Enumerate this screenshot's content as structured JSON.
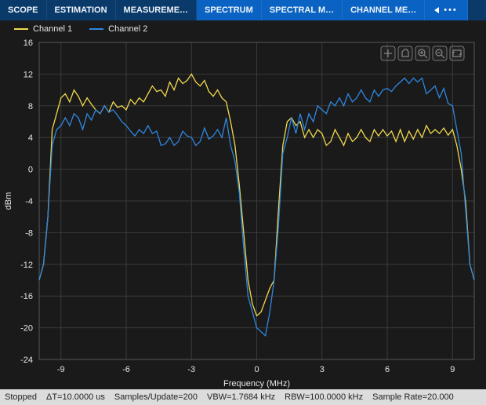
{
  "tabs": {
    "scope": "SCOPE",
    "estimation": "ESTIMATION",
    "measure": "MEASUREME…",
    "spectrum": "SPECTRUM",
    "spectral": "SPECTRAL M…",
    "channel": "CHANNEL ME…",
    "more": "•••"
  },
  "legend": {
    "ch1": {
      "label": "Channel 1",
      "color": "#f2d94e"
    },
    "ch2": {
      "label": "Channel 2",
      "color": "#2f87e0"
    }
  },
  "axes": {
    "xlabel": "Frequency (MHz)",
    "ylabel": "dBm"
  },
  "status": {
    "state": "Stopped",
    "dt": "ΔT=10.0000 us",
    "spu": "Samples/Update=200",
    "vbw": "VBW=1.7684 kHz",
    "rbw": "RBW=100.0000 kHz",
    "sr": "Sample Rate=20.000"
  },
  "chart_data": {
    "type": "line",
    "xlabel": "Frequency (MHz)",
    "ylabel": "dBm",
    "xlim": [
      -10,
      10
    ],
    "ylim": [
      -24,
      16
    ],
    "xticks": [
      -9,
      -6,
      -3,
      0,
      3,
      6,
      9
    ],
    "yticks": [
      -24,
      -20,
      -16,
      -12,
      -8,
      -4,
      0,
      4,
      8,
      12,
      16
    ],
    "series": [
      {
        "name": "Channel 1",
        "color": "#f2d94e",
        "x": [
          -10,
          -9.8,
          -9.6,
          -9.4,
          -9.2,
          -9,
          -8.8,
          -8.6,
          -8.4,
          -8.2,
          -8,
          -7.8,
          -7.6,
          -7.4,
          -7.2,
          -7,
          -6.8,
          -6.6,
          -6.4,
          -6.2,
          -6,
          -5.8,
          -5.6,
          -5.4,
          -5.2,
          -5,
          -4.8,
          -4.6,
          -4.4,
          -4.2,
          -4,
          -3.8,
          -3.6,
          -3.4,
          -3.2,
          -3,
          -2.8,
          -2.6,
          -2.4,
          -2.2,
          -2,
          -1.8,
          -1.6,
          -1.4,
          -1.2,
          -1,
          -0.8,
          -0.6,
          -0.4,
          -0.2,
          0,
          0.2,
          0.4,
          0.6,
          0.8,
          1,
          1.2,
          1.4,
          1.6,
          1.8,
          2,
          2.2,
          2.4,
          2.6,
          2.8,
          3,
          3.2,
          3.4,
          3.6,
          3.8,
          4,
          4.2,
          4.4,
          4.6,
          4.8,
          5,
          5.2,
          5.4,
          5.6,
          5.8,
          6,
          6.2,
          6.4,
          6.6,
          6.8,
          7,
          7.2,
          7.4,
          7.6,
          7.8,
          8,
          8.2,
          8.4,
          8.6,
          8.8,
          9,
          9.2,
          9.4,
          9.6,
          9.8,
          10
        ],
        "y": [
          -14,
          -12,
          -6,
          5,
          7,
          9,
          9.5,
          8.5,
          10,
          9.2,
          8,
          9,
          8.2,
          7.5,
          7,
          8,
          7.2,
          8.5,
          7.8,
          8,
          7.5,
          8.8,
          8.2,
          9,
          8.5,
          9.5,
          10.5,
          9.8,
          10,
          9.2,
          11,
          10,
          11.5,
          10.8,
          11.2,
          12,
          11,
          10.5,
          11.2,
          9.8,
          9.2,
          10,
          9,
          8.5,
          6,
          3,
          -2,
          -8,
          -14,
          -17,
          -18.5,
          -18,
          -16.5,
          -15,
          -14,
          -5,
          3,
          6,
          6.5,
          5.5,
          6,
          4,
          5,
          4,
          5,
          4.5,
          3,
          3.5,
          5,
          4,
          3,
          4.5,
          3.5,
          4,
          5,
          4,
          3.5,
          5,
          4.2,
          5,
          4.2,
          4.8,
          3.5,
          5,
          3.5,
          4.8,
          3.8,
          5,
          4,
          5.5,
          4.5,
          5,
          4.5,
          5.2,
          4.3,
          5,
          3,
          0,
          -4,
          -12,
          -14
        ]
      },
      {
        "name": "Channel 2",
        "color": "#2f87e0",
        "x": [
          -10,
          -9.8,
          -9.6,
          -9.4,
          -9.2,
          -9,
          -8.8,
          -8.6,
          -8.4,
          -8.2,
          -8,
          -7.8,
          -7.6,
          -7.4,
          -7.2,
          -7,
          -6.8,
          -6.6,
          -6.4,
          -6.2,
          -6,
          -5.8,
          -5.6,
          -5.4,
          -5.2,
          -5,
          -4.8,
          -4.6,
          -4.4,
          -4.2,
          -4,
          -3.8,
          -3.6,
          -3.4,
          -3.2,
          -3,
          -2.8,
          -2.6,
          -2.4,
          -2.2,
          -2,
          -1.8,
          -1.6,
          -1.4,
          -1.2,
          -1,
          -0.8,
          -0.6,
          -0.4,
          -0.2,
          0,
          0.2,
          0.4,
          0.6,
          0.8,
          1,
          1.2,
          1.4,
          1.6,
          1.8,
          2,
          2.2,
          2.4,
          2.6,
          2.8,
          3,
          3.2,
          3.4,
          3.6,
          3.8,
          4,
          4.2,
          4.4,
          4.6,
          4.8,
          5,
          5.2,
          5.4,
          5.6,
          5.8,
          6,
          6.2,
          6.4,
          6.6,
          6.8,
          7,
          7.2,
          7.4,
          7.6,
          7.8,
          8,
          8.2,
          8.4,
          8.6,
          8.8,
          9,
          9.2,
          9.4,
          9.6,
          9.8,
          10
        ],
        "y": [
          -14,
          -12,
          -6,
          3,
          5,
          5.5,
          6.5,
          5.5,
          7,
          6.5,
          5,
          7,
          6.2,
          7.5,
          7,
          8,
          7.2,
          7.5,
          6.8,
          6,
          5.5,
          4.8,
          4.2,
          5,
          4.5,
          5.5,
          4.5,
          4.8,
          3,
          3.2,
          4,
          3,
          3.5,
          4.8,
          4.2,
          4,
          3,
          3.5,
          5.2,
          3.8,
          4.2,
          5,
          4,
          6.5,
          3,
          1,
          -3,
          -10,
          -16,
          -18,
          -20,
          -20.5,
          -21,
          -18,
          -14,
          -7,
          2,
          4,
          6.5,
          4.5,
          7,
          5,
          7,
          6,
          8,
          7.5,
          7,
          8.5,
          8,
          9,
          8,
          9.5,
          8.5,
          9,
          10,
          9,
          8.5,
          10,
          9.2,
          10,
          10.2,
          9.8,
          10.5,
          11,
          11.5,
          10.8,
          11.5,
          11,
          11.5,
          9.5,
          10,
          10.5,
          9,
          10.2,
          8.3,
          8,
          5,
          2,
          -5,
          -12,
          -14
        ]
      }
    ]
  }
}
